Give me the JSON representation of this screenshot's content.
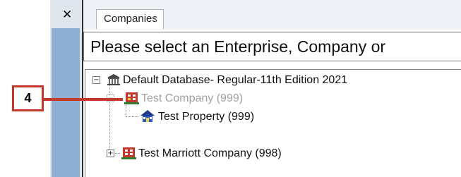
{
  "window": {
    "close_glyph": "✕"
  },
  "tabs": [
    {
      "label": "Companies",
      "close_glyph": "×"
    }
  ],
  "prompt": {
    "text": "Please select an Enterprise, Company or"
  },
  "tree": {
    "root": {
      "label": "Default Database- Regular-11th Edition 2021",
      "expander": "−",
      "icon": "database-building-icon"
    },
    "items": [
      {
        "label": "Test Company (999)",
        "expander": "−",
        "icon": "company-icon",
        "state": "dimmed"
      },
      {
        "label": "Test Property (999)",
        "icon": "property-house-icon"
      },
      {
        "label": "Test Marriott Company (998)",
        "expander": "+",
        "icon": "company-icon"
      }
    ]
  },
  "callout": {
    "number": "4",
    "color": "#c0392b"
  }
}
